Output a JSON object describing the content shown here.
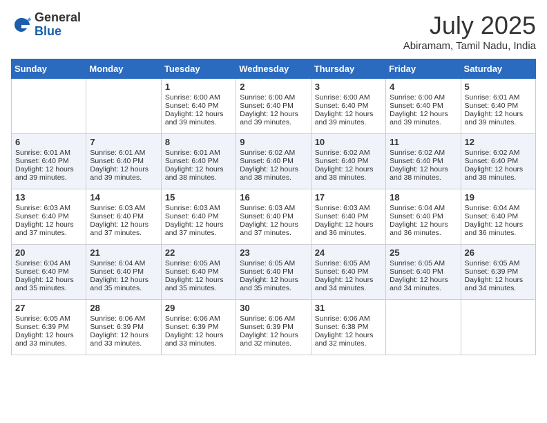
{
  "header": {
    "logo_general": "General",
    "logo_blue": "Blue",
    "month_year": "July 2025",
    "location": "Abiramam, Tamil Nadu, India"
  },
  "days_of_week": [
    "Sunday",
    "Monday",
    "Tuesday",
    "Wednesday",
    "Thursday",
    "Friday",
    "Saturday"
  ],
  "weeks": [
    [
      {
        "day": "",
        "empty": true
      },
      {
        "day": "",
        "empty": true
      },
      {
        "day": "1",
        "sunrise": "Sunrise: 6:00 AM",
        "sunset": "Sunset: 6:40 PM",
        "daylight": "Daylight: 12 hours and 39 minutes."
      },
      {
        "day": "2",
        "sunrise": "Sunrise: 6:00 AM",
        "sunset": "Sunset: 6:40 PM",
        "daylight": "Daylight: 12 hours and 39 minutes."
      },
      {
        "day": "3",
        "sunrise": "Sunrise: 6:00 AM",
        "sunset": "Sunset: 6:40 PM",
        "daylight": "Daylight: 12 hours and 39 minutes."
      },
      {
        "day": "4",
        "sunrise": "Sunrise: 6:00 AM",
        "sunset": "Sunset: 6:40 PM",
        "daylight": "Daylight: 12 hours and 39 minutes."
      },
      {
        "day": "5",
        "sunrise": "Sunrise: 6:01 AM",
        "sunset": "Sunset: 6:40 PM",
        "daylight": "Daylight: 12 hours and 39 minutes."
      }
    ],
    [
      {
        "day": "6",
        "sunrise": "Sunrise: 6:01 AM",
        "sunset": "Sunset: 6:40 PM",
        "daylight": "Daylight: 12 hours and 39 minutes."
      },
      {
        "day": "7",
        "sunrise": "Sunrise: 6:01 AM",
        "sunset": "Sunset: 6:40 PM",
        "daylight": "Daylight: 12 hours and 39 minutes."
      },
      {
        "day": "8",
        "sunrise": "Sunrise: 6:01 AM",
        "sunset": "Sunset: 6:40 PM",
        "daylight": "Daylight: 12 hours and 38 minutes."
      },
      {
        "day": "9",
        "sunrise": "Sunrise: 6:02 AM",
        "sunset": "Sunset: 6:40 PM",
        "daylight": "Daylight: 12 hours and 38 minutes."
      },
      {
        "day": "10",
        "sunrise": "Sunrise: 6:02 AM",
        "sunset": "Sunset: 6:40 PM",
        "daylight": "Daylight: 12 hours and 38 minutes."
      },
      {
        "day": "11",
        "sunrise": "Sunrise: 6:02 AM",
        "sunset": "Sunset: 6:40 PM",
        "daylight": "Daylight: 12 hours and 38 minutes."
      },
      {
        "day": "12",
        "sunrise": "Sunrise: 6:02 AM",
        "sunset": "Sunset: 6:40 PM",
        "daylight": "Daylight: 12 hours and 38 minutes."
      }
    ],
    [
      {
        "day": "13",
        "sunrise": "Sunrise: 6:03 AM",
        "sunset": "Sunset: 6:40 PM",
        "daylight": "Daylight: 12 hours and 37 minutes."
      },
      {
        "day": "14",
        "sunrise": "Sunrise: 6:03 AM",
        "sunset": "Sunset: 6:40 PM",
        "daylight": "Daylight: 12 hours and 37 minutes."
      },
      {
        "day": "15",
        "sunrise": "Sunrise: 6:03 AM",
        "sunset": "Sunset: 6:40 PM",
        "daylight": "Daylight: 12 hours and 37 minutes."
      },
      {
        "day": "16",
        "sunrise": "Sunrise: 6:03 AM",
        "sunset": "Sunset: 6:40 PM",
        "daylight": "Daylight: 12 hours and 37 minutes."
      },
      {
        "day": "17",
        "sunrise": "Sunrise: 6:03 AM",
        "sunset": "Sunset: 6:40 PM",
        "daylight": "Daylight: 12 hours and 36 minutes."
      },
      {
        "day": "18",
        "sunrise": "Sunrise: 6:04 AM",
        "sunset": "Sunset: 6:40 PM",
        "daylight": "Daylight: 12 hours and 36 minutes."
      },
      {
        "day": "19",
        "sunrise": "Sunrise: 6:04 AM",
        "sunset": "Sunset: 6:40 PM",
        "daylight": "Daylight: 12 hours and 36 minutes."
      }
    ],
    [
      {
        "day": "20",
        "sunrise": "Sunrise: 6:04 AM",
        "sunset": "Sunset: 6:40 PM",
        "daylight": "Daylight: 12 hours and 35 minutes."
      },
      {
        "day": "21",
        "sunrise": "Sunrise: 6:04 AM",
        "sunset": "Sunset: 6:40 PM",
        "daylight": "Daylight: 12 hours and 35 minutes."
      },
      {
        "day": "22",
        "sunrise": "Sunrise: 6:05 AM",
        "sunset": "Sunset: 6:40 PM",
        "daylight": "Daylight: 12 hours and 35 minutes."
      },
      {
        "day": "23",
        "sunrise": "Sunrise: 6:05 AM",
        "sunset": "Sunset: 6:40 PM",
        "daylight": "Daylight: 12 hours and 35 minutes."
      },
      {
        "day": "24",
        "sunrise": "Sunrise: 6:05 AM",
        "sunset": "Sunset: 6:40 PM",
        "daylight": "Daylight: 12 hours and 34 minutes."
      },
      {
        "day": "25",
        "sunrise": "Sunrise: 6:05 AM",
        "sunset": "Sunset: 6:40 PM",
        "daylight": "Daylight: 12 hours and 34 minutes."
      },
      {
        "day": "26",
        "sunrise": "Sunrise: 6:05 AM",
        "sunset": "Sunset: 6:39 PM",
        "daylight": "Daylight: 12 hours and 34 minutes."
      }
    ],
    [
      {
        "day": "27",
        "sunrise": "Sunrise: 6:05 AM",
        "sunset": "Sunset: 6:39 PM",
        "daylight": "Daylight: 12 hours and 33 minutes."
      },
      {
        "day": "28",
        "sunrise": "Sunrise: 6:06 AM",
        "sunset": "Sunset: 6:39 PM",
        "daylight": "Daylight: 12 hours and 33 minutes."
      },
      {
        "day": "29",
        "sunrise": "Sunrise: 6:06 AM",
        "sunset": "Sunset: 6:39 PM",
        "daylight": "Daylight: 12 hours and 33 minutes."
      },
      {
        "day": "30",
        "sunrise": "Sunrise: 6:06 AM",
        "sunset": "Sunset: 6:39 PM",
        "daylight": "Daylight: 12 hours and 32 minutes."
      },
      {
        "day": "31",
        "sunrise": "Sunrise: 6:06 AM",
        "sunset": "Sunset: 6:38 PM",
        "daylight": "Daylight: 12 hours and 32 minutes."
      },
      {
        "day": "",
        "empty": true
      },
      {
        "day": "",
        "empty": true
      }
    ]
  ]
}
